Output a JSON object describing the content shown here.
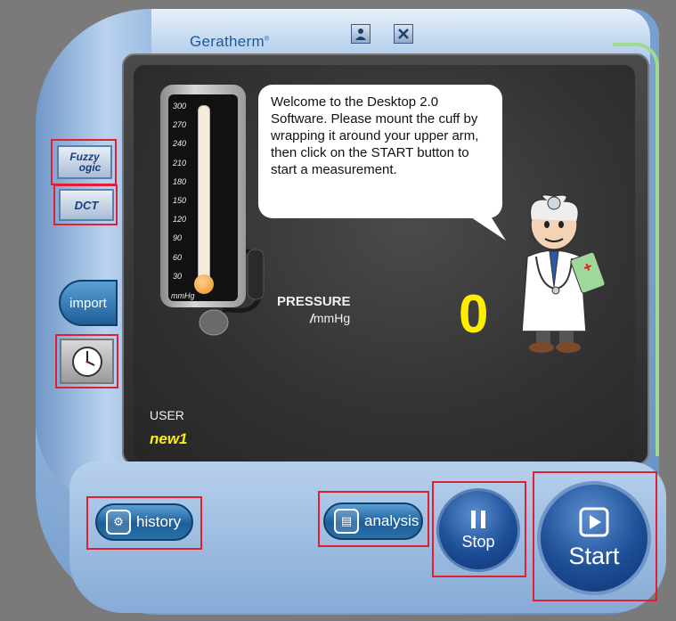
{
  "app": {
    "brand": "Geratherm",
    "brand_mark": "®"
  },
  "window_controls": {
    "user_icon": "person-icon",
    "close_icon": "close-icon"
  },
  "side_buttons": {
    "fuzzy_logic": {
      "line1": "Fuzzy",
      "line2": "ogic"
    },
    "dct": "DCT",
    "import": "import",
    "clock_icon": "clock-icon"
  },
  "gauge": {
    "ticks": [
      "300",
      "270",
      "240",
      "210",
      "180",
      "150",
      "120",
      "90",
      "60",
      "30"
    ],
    "unit": "mmHg"
  },
  "message": "Welcome to the Desktop 2.0 Software. Please mount the cuff by wrapping it around your upper arm, then click on the START button to start a measurement.",
  "pressure": {
    "label": "PRESSURE",
    "unit_prefix": "/",
    "unit": "mmHg",
    "value": "0"
  },
  "user": {
    "label": "USER",
    "name": "new1"
  },
  "actions": {
    "history": "history",
    "analysis": "analysis",
    "stop": "Stop",
    "start": "Start"
  },
  "colors": {
    "highlight_box": "#e02030",
    "value_yellow": "#ffee00",
    "button_blue": "#1d4e96"
  }
}
